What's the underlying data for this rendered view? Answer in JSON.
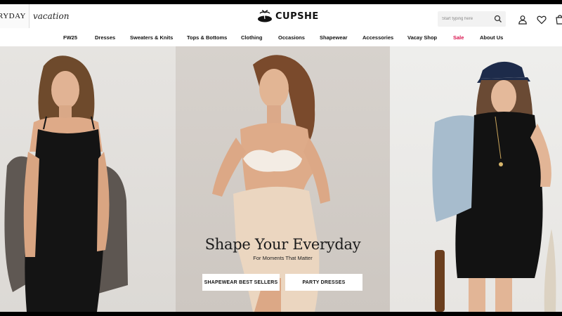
{
  "header": {
    "brand_tabs": [
      "EVERYDAY",
      "vacation"
    ],
    "logo_text": "CUPSHE",
    "logo_icon": "palm-tree-icon",
    "search": {
      "placeholder": "Start typing here"
    },
    "icons": [
      "search-icon",
      "account-icon",
      "heart-icon",
      "cart-icon"
    ]
  },
  "nav": {
    "items": [
      {
        "label": "FW25"
      },
      {
        "label": "Dresses"
      },
      {
        "label": "Sweaters & Knits"
      },
      {
        "label": "Tops & Bottoms"
      },
      {
        "label": "Clothing"
      },
      {
        "label": "Occasions"
      },
      {
        "label": "Shapewear"
      },
      {
        "label": "Accessories"
      },
      {
        "label": "Vacay Shop"
      },
      {
        "label": "Sale"
      },
      {
        "label": "About Us"
      }
    ],
    "sale_color": "#d9144e"
  },
  "hero": {
    "title": "Shape Your Everyday",
    "subtitle": "For Moments That Matter",
    "buttons": [
      "SHAPEWEAR BEST SELLERS",
      "PARTY DRESSES"
    ]
  }
}
